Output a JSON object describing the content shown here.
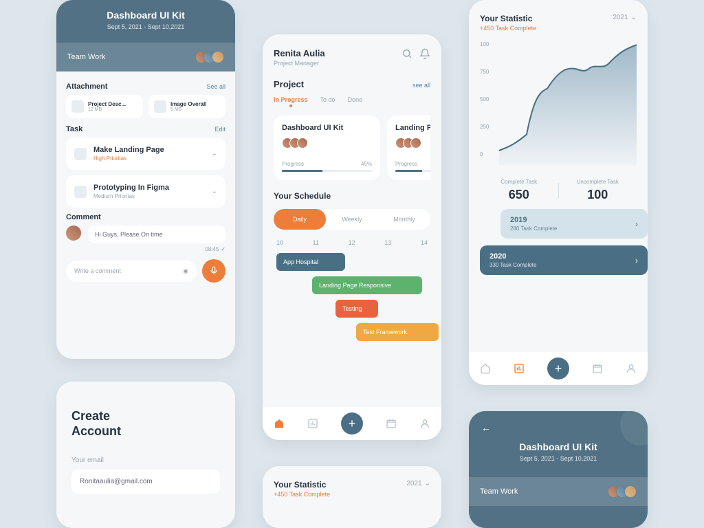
{
  "colors": {
    "teal": "#4a6f85",
    "orange": "#ed7d3a",
    "green": "#5bb36e",
    "amber": "#f0a843",
    "red": "#e8623e"
  },
  "p1": {
    "title": "Dashboard UI Kit",
    "date": "Sept 5, 2021 - Sept 10,2021",
    "team_label": "Team Work",
    "attach_title": "Attachment",
    "attach_link": "See all",
    "attachments": [
      {
        "name": "Project Desc...",
        "size": "12 MB"
      },
      {
        "name": "Image Overall",
        "size": "5 MB"
      }
    ],
    "task_title": "Task",
    "task_link": "Edit",
    "tasks": [
      {
        "name": "Make Landing Page",
        "priority": "High Prioritas"
      },
      {
        "name": "Prototyping In Figma",
        "priority": "Medium Prioritas"
      }
    ],
    "comment_title": "Comment",
    "comment_text": "Hi Guys, Please On time",
    "comment_time": "08:45",
    "comment_placeholder": "Write a comment"
  },
  "p2": {
    "title_l1": "Create",
    "title_l2": "Account",
    "email_label": "Your email",
    "email_value": "Ronitaaulia@gmail.com"
  },
  "p3": {
    "name": "Renita Aulia",
    "role": "Project Manager",
    "project_title": "Project",
    "project_link": "see all",
    "tabs": [
      "In Progress",
      "To do",
      "Done"
    ],
    "projects": [
      {
        "title": "Dashboard UI Kit",
        "progress_label": "Progress",
        "progress_pct": "45%"
      },
      {
        "title": "Landing P",
        "progress_label": "Progress",
        "progress_pct": ""
      }
    ],
    "schedule_title": "Your Schedule",
    "sched_tabs": [
      "Daily",
      "Weekly",
      "Monthly"
    ],
    "times": [
      "10",
      "11",
      "12",
      "13",
      "14"
    ],
    "gantt": [
      "App Hospital",
      "Landing Page Responsive",
      "Testing",
      "Test Framework"
    ]
  },
  "p4": {
    "title": "Your Statistic",
    "sub": "+450 Task Complete",
    "year": "2021"
  },
  "p5": {
    "title": "Your Statistic",
    "sub": "+450 Task Complete",
    "year": "2021",
    "y_ticks": [
      "100",
      "750",
      "500",
      "250",
      "0"
    ],
    "complete_label": "Complete Task",
    "complete_val": "650",
    "uncomplete_label": "Uncomplete Task",
    "uncomplete_val": "100",
    "years": [
      {
        "year": "2019",
        "sub": "280 Task Complete"
      },
      {
        "year": "2020",
        "sub": "330 Task Complete"
      }
    ]
  },
  "p6": {
    "title": "Dashboard UI Kit",
    "date": "Sept 5, 2021 - Sept 10,2021",
    "team_label": "Team Work"
  },
  "chart_data": {
    "type": "area",
    "title": "Your Statistic",
    "ylabel": "",
    "ylim": [
      0,
      1000
    ],
    "x": [
      0,
      1,
      2,
      3,
      4,
      5,
      6,
      7,
      8,
      9
    ],
    "values": [
      120,
      180,
      250,
      520,
      600,
      780,
      820,
      800,
      870,
      980
    ]
  }
}
